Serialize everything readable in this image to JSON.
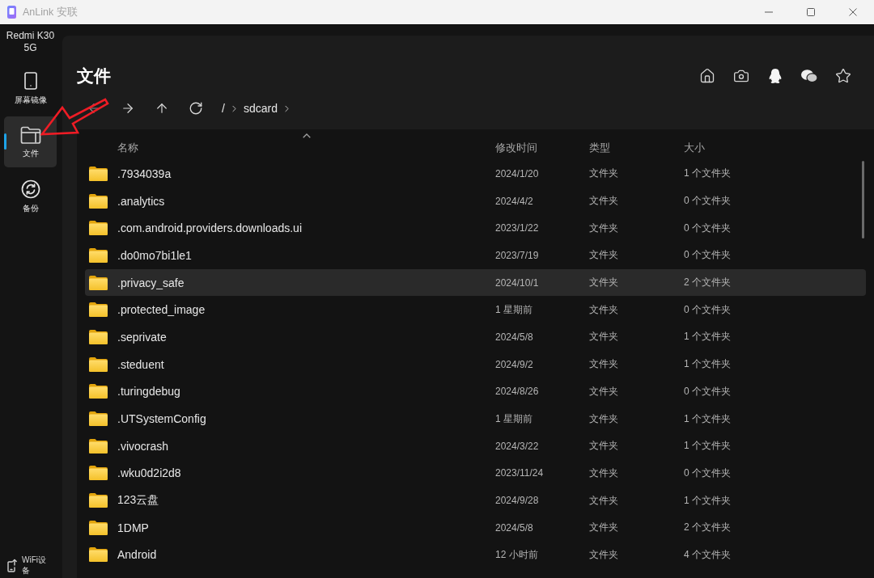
{
  "window": {
    "title": "AnLink 安联"
  },
  "sidebar": {
    "device": "Redmi K30 5G",
    "items": [
      {
        "kind": "mirror",
        "label": "屏幕镜像",
        "selected": false
      },
      {
        "kind": "files",
        "label": "文件",
        "selected": true
      },
      {
        "kind": "backup",
        "label": "备份",
        "selected": false
      }
    ],
    "footer": "WiFi设备"
  },
  "page": {
    "title": "文件",
    "path": [
      "/",
      "sdcard"
    ]
  },
  "table": {
    "columns": [
      {
        "label": "名称",
        "sorted": true
      },
      {
        "label": "修改时间",
        "sorted": false
      },
      {
        "label": "类型",
        "sorted": false
      },
      {
        "label": "大小",
        "sorted": false
      }
    ],
    "rows": [
      {
        "name": ".7934039a",
        "modified": "2024/1/20",
        "type": "文件夹",
        "size": "1 个文件夹",
        "selected": false
      },
      {
        "name": ".analytics",
        "modified": "2024/4/2",
        "type": "文件夹",
        "size": "0 个文件夹",
        "selected": false
      },
      {
        "name": ".com.android.providers.downloads.ui",
        "modified": "2023/1/22",
        "type": "文件夹",
        "size": "0 个文件夹",
        "selected": false
      },
      {
        "name": ".do0mo7bi1le1",
        "modified": "2023/7/19",
        "type": "文件夹",
        "size": "0 个文件夹",
        "selected": false
      },
      {
        "name": ".privacy_safe",
        "modified": "2024/10/1",
        "type": "文件夹",
        "size": "2 个文件夹",
        "selected": true
      },
      {
        "name": ".protected_image",
        "modified": "1 星期前",
        "type": "文件夹",
        "size": "0 个文件夹",
        "selected": false
      },
      {
        "name": ".seprivate",
        "modified": "2024/5/8",
        "type": "文件夹",
        "size": "1 个文件夹",
        "selected": false
      },
      {
        "name": ".steduent",
        "modified": "2024/9/2",
        "type": "文件夹",
        "size": "1 个文件夹",
        "selected": false
      },
      {
        "name": ".turingdebug",
        "modified": "2024/8/26",
        "type": "文件夹",
        "size": "0 个文件夹",
        "selected": false
      },
      {
        "name": ".UTSystemConfig",
        "modified": "1 星期前",
        "type": "文件夹",
        "size": "1 个文件夹",
        "selected": false
      },
      {
        "name": ".vivocrash",
        "modified": "2024/3/22",
        "type": "文件夹",
        "size": "1 个文件夹",
        "selected": false
      },
      {
        "name": ".wku0d2i2d8",
        "modified": "2023/11/24",
        "type": "文件夹",
        "size": "0 个文件夹",
        "selected": false
      },
      {
        "name": "123云盘",
        "modified": "2024/9/28",
        "type": "文件夹",
        "size": "1 个文件夹",
        "selected": false
      },
      {
        "name": "1DMP",
        "modified": "2024/5/8",
        "type": "文件夹",
        "size": "2 个文件夹",
        "selected": false
      },
      {
        "name": "Android",
        "modified": "12 小时前",
        "type": "文件夹",
        "size": "4 个文件夹",
        "selected": false
      }
    ]
  }
}
